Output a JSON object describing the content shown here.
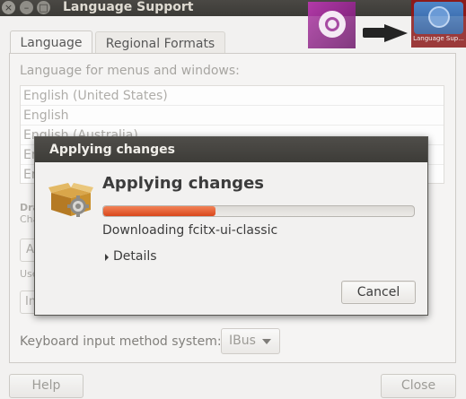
{
  "window": {
    "title": "Language Support",
    "close_glyph": "×",
    "min_glyph": "–",
    "max_glyph": "□"
  },
  "overlay": {
    "target_app_label": "Language Sup..."
  },
  "tabs": [
    {
      "label": "Language",
      "active": true
    },
    {
      "label": "Regional Formats",
      "active": false
    }
  ],
  "language_panel": {
    "heading": "Language for menus and windows:",
    "languages": [
      "English (United States)",
      "English",
      "English (Australia)",
      "En",
      "En"
    ],
    "fragments": {
      "drag": "Dra",
      "changes": "Cha",
      "apply_box": "A",
      "use": "Use",
      "install_box": "In"
    },
    "keyboard_label": "Keyboard input method system:",
    "keyboard_value": "IBus"
  },
  "buttons": {
    "help": "Help",
    "close": "Close"
  },
  "dialog": {
    "title": "Applying changes",
    "heading": "Applying changes",
    "status": "Downloading fcitx-ui-classic",
    "progress_fraction": 0.36,
    "details_label": "Details",
    "cancel_label": "Cancel",
    "accent_color": "#e5582a"
  }
}
